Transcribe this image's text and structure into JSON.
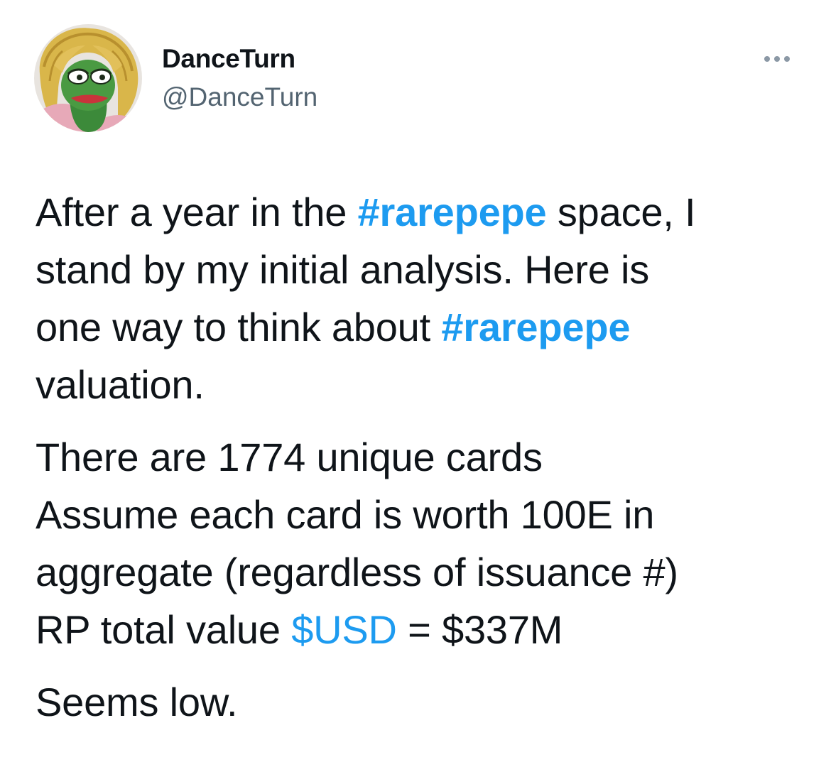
{
  "theme": {
    "link_color": "#1d9bf0",
    "text_color": "#0f1419",
    "secondary_text": "#536471"
  },
  "author": {
    "display_name": "DanceTurn",
    "handle": "@DanceTurn",
    "avatar": "pepe-frog-avatar"
  },
  "menu": {
    "icon": "more-icon"
  },
  "tweet": {
    "p1": {
      "l1_a": "After a year in the ",
      "l1_tag": "#rarepepe",
      "l1_b": " space, I",
      "l2": "stand by my initial analysis. Here is",
      "l3_a": "one way to think about ",
      "l3_tag": "#rarepepe",
      "l4": "valuation."
    },
    "p2": {
      "l1": "There are 1774 unique cards",
      "l2": "Assume each card is worth 100E in",
      "l3": "aggregate (regardless of issuance #)",
      "l4_a": "RP total value ",
      "l4_cash": "$USD",
      "l4_b": " = $337M"
    },
    "p3": {
      "l1": "Seems low."
    }
  }
}
